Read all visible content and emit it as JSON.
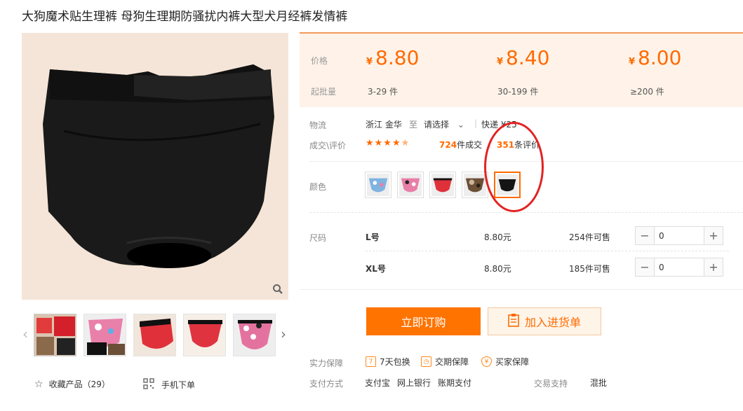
{
  "product": {
    "title": "大狗魔术贴生理裤 母狗生理期防骚扰内裤大型犬月经裤发情裤"
  },
  "price": {
    "price_label": "价格",
    "qty_label": "起批量",
    "currency": "¥",
    "tiers": [
      {
        "price": "8.80",
        "qty": "3-29 件"
      },
      {
        "price": "8.40",
        "qty": "30-199 件"
      },
      {
        "price": "8.00",
        "qty": "≥200 件"
      }
    ]
  },
  "logistics": {
    "label": "物流",
    "origin": "浙江 金华",
    "to": "至",
    "destination": "请选择",
    "express": "快递 ¥25"
  },
  "deals": {
    "label": "成交\\评价",
    "rating": 4.5,
    "sold_count": "724",
    "sold_text": "件成交",
    "review_count": "351",
    "review_text": "条评价"
  },
  "colors": {
    "label": "颜色",
    "options": [
      {
        "name": "blue-pattern",
        "color": "#7fb3e0"
      },
      {
        "name": "pink-pattern",
        "color": "#e87fa8"
      },
      {
        "name": "red",
        "color": "#e0313b"
      },
      {
        "name": "camo",
        "color": "#6b4f36"
      },
      {
        "name": "black",
        "color": "#151515"
      }
    ],
    "selected_index": 4
  },
  "sizes": {
    "label": "尺码",
    "rows": [
      {
        "name": "L号",
        "price": "8.80元",
        "stock": "254件可售",
        "qty": "0"
      },
      {
        "name": "XL号",
        "price": "8.80元",
        "stock": "185件可售",
        "qty": "0"
      }
    ]
  },
  "actions": {
    "order": "立即订购",
    "cart": "加入进货单"
  },
  "guarantee": {
    "label": "实力保障",
    "items": [
      "7天包换",
      "交期保障",
      "买家保障"
    ]
  },
  "payment": {
    "label": "支付方式",
    "methods": [
      "支付宝",
      "网上银行",
      "账期支付"
    ],
    "trade_label": "交易支持",
    "trade_value": "混批"
  },
  "sidebar": {
    "favorite": "收藏产品（29）",
    "mobile": "手机下单"
  },
  "colors_theme": {
    "accent": "#ff6a00",
    "price_bg": "#fff3e9",
    "annotation": "#e32222"
  }
}
